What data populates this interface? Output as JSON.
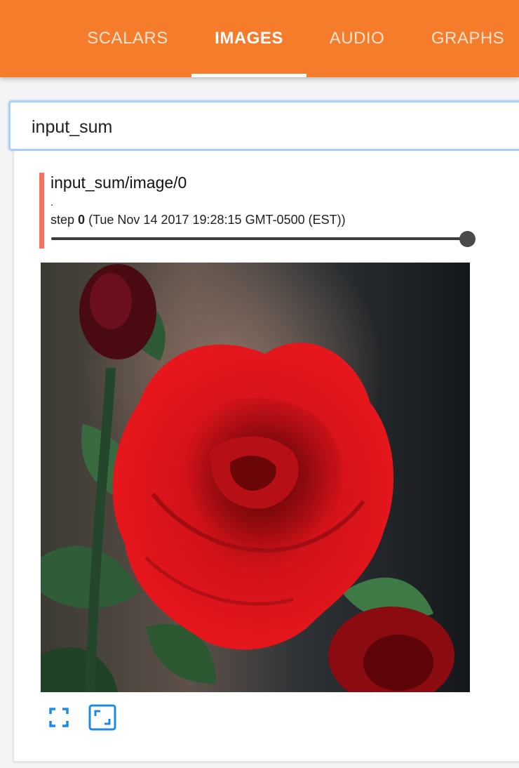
{
  "tabs": [
    {
      "label": "SCALARS",
      "active": false
    },
    {
      "label": "IMAGES",
      "active": true
    },
    {
      "label": "AUDIO",
      "active": false
    },
    {
      "label": "GRAPHS",
      "active": false
    }
  ],
  "colors": {
    "header": "#f57c2b",
    "accent": "#f4735a",
    "icon": "#1e88e5"
  },
  "search": {
    "value": "input_sum"
  },
  "card": {
    "title": "input_sum/image/0",
    "dot": ".",
    "step_prefix": "step",
    "step_value": "0",
    "step_time": "(Tue Nov 14 2017 19:28:15 GMT-0500 (EST))"
  },
  "slider": {
    "value_fraction": 1.0
  },
  "image": {
    "subject": "red-rose-photo"
  },
  "icons": {
    "fullscreen": "fullscreen-icon",
    "actual_size": "actual-size-icon"
  }
}
